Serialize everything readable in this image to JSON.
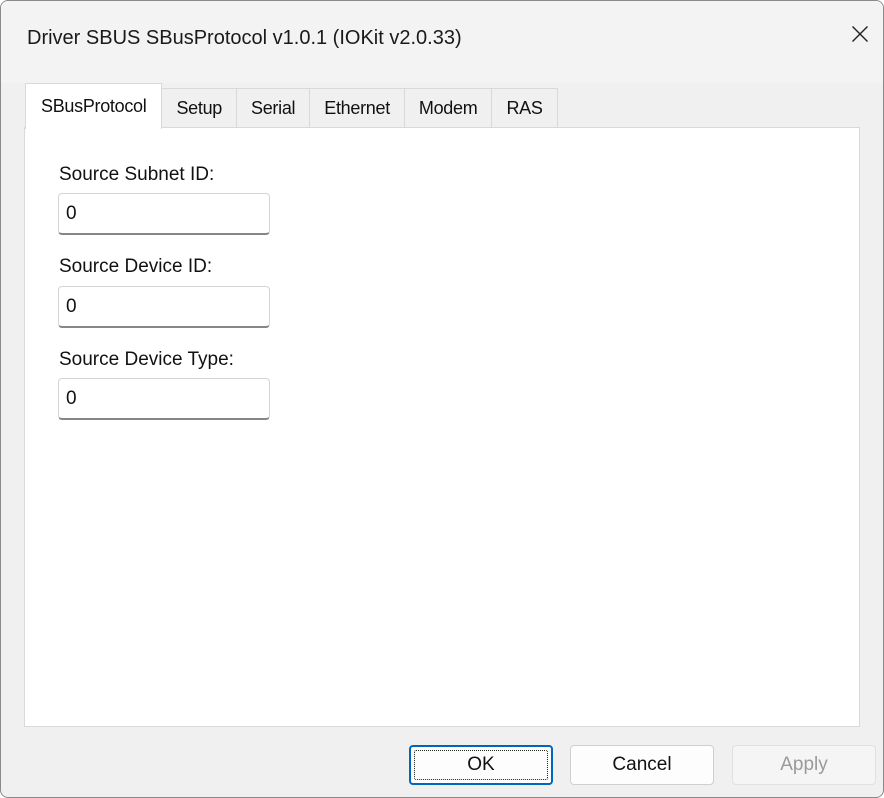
{
  "window": {
    "title": "Driver SBUS SBusProtocol v1.0.1 (IOKit v2.0.33)",
    "close_icon": "close-icon"
  },
  "tabs": [
    {
      "label": "SBusProtocol",
      "active": true
    },
    {
      "label": "Setup",
      "active": false
    },
    {
      "label": "Serial",
      "active": false
    },
    {
      "label": "Ethernet",
      "active": false
    },
    {
      "label": "Modem",
      "active": false
    },
    {
      "label": "RAS",
      "active": false
    }
  ],
  "fields": {
    "subnet": {
      "label": "Source Subnet ID:",
      "value": "0"
    },
    "device": {
      "label": "Source Device ID:",
      "value": "0"
    },
    "type": {
      "label": "Source Device Type:",
      "value": "0"
    }
  },
  "buttons": {
    "ok": "OK",
    "cancel": "Cancel",
    "apply": "Apply"
  },
  "colors": {
    "accent": "#0067c0",
    "panel": "#ffffff",
    "chrome": "#f0f0f0"
  }
}
